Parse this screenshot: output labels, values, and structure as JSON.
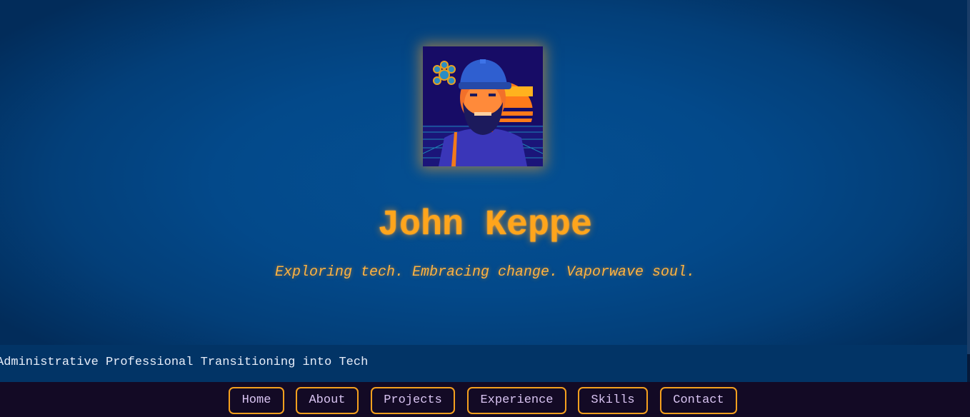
{
  "hero": {
    "name": "John Keppe",
    "tagline": "Exploring tech. Embracing change. Vaporwave soul."
  },
  "ticker": {
    "text": "Administrative Professional Transitioning into Tech"
  },
  "nav": {
    "items": [
      {
        "label": "Home"
      },
      {
        "label": "About"
      },
      {
        "label": "Projects"
      },
      {
        "label": "Experience"
      },
      {
        "label": "Skills"
      },
      {
        "label": "Contact"
      }
    ]
  },
  "colors": {
    "accent": "#ffa51c",
    "hero_background": "#03498a",
    "ticker_background": "#023466",
    "nav_background": "#130a25",
    "nav_text": "#d9c4f2"
  },
  "icons": {
    "avatar": "pixel-art-portrait"
  }
}
